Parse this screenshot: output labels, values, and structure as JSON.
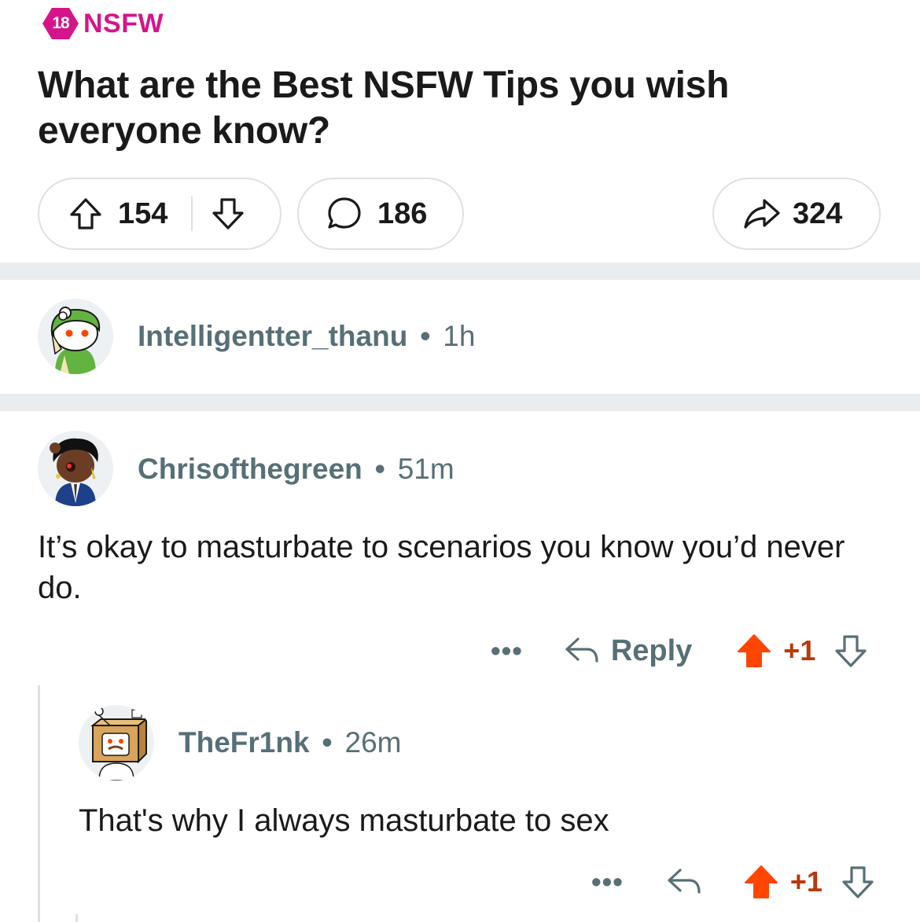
{
  "post": {
    "nsfw_badge": "18",
    "nsfw_label": "NSFW",
    "title": "What are the Best NSFW Tips you wish everyone know?",
    "upvotes": "154",
    "comments": "186",
    "shares": "324"
  },
  "comments": [
    {
      "author": "Intelligentter_thanu",
      "separator": "•",
      "time": "1h"
    },
    {
      "author": "Chrisofthegreen",
      "separator": "•",
      "time": "51m",
      "body": "It’s okay to masturbate to scenarios you know you’d never do.",
      "more": "•••",
      "reply_label": "Reply",
      "score": "+1"
    },
    {
      "author": "TheFr1nk",
      "separator": "•",
      "time": "26m",
      "body": "That's why I always masturbate to sex",
      "more": "•••",
      "score": "+1"
    }
  ],
  "colors": {
    "nsfw": "#d6148a",
    "upvote_active": "#ff4500",
    "score_active": "#b83a0a",
    "meta_text": "#576f76",
    "divider": "#eaedef"
  }
}
